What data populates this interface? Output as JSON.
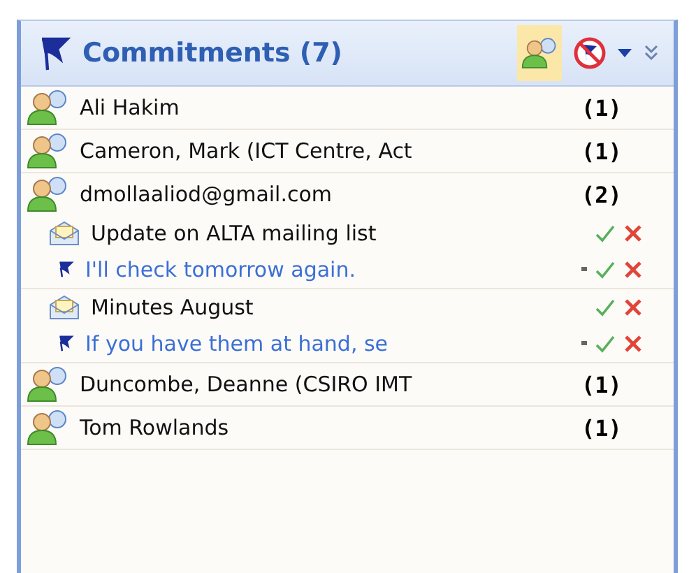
{
  "header": {
    "title": "Commitments (7)",
    "people_filter_active": true
  },
  "contacts": [
    {
      "name": "Ali Hakim",
      "count": "(1)"
    },
    {
      "name": "Cameron, Mark (ICT Centre, Act",
      "count": "(1)"
    },
    {
      "name": "dmollaaliod@gmail.com",
      "count": "(2)",
      "messages": [
        {
          "subject": "Update on ALTA mailing list",
          "commitment": "I'll check tomorrow again."
        },
        {
          "subject": "Minutes August",
          "commitment": "If you have them at hand, se"
        }
      ]
    },
    {
      "name": "Duncombe, Deanne (CSIRO IMT",
      "count": "(1)"
    },
    {
      "name": "Tom Rowlands",
      "count": "(1)"
    }
  ]
}
